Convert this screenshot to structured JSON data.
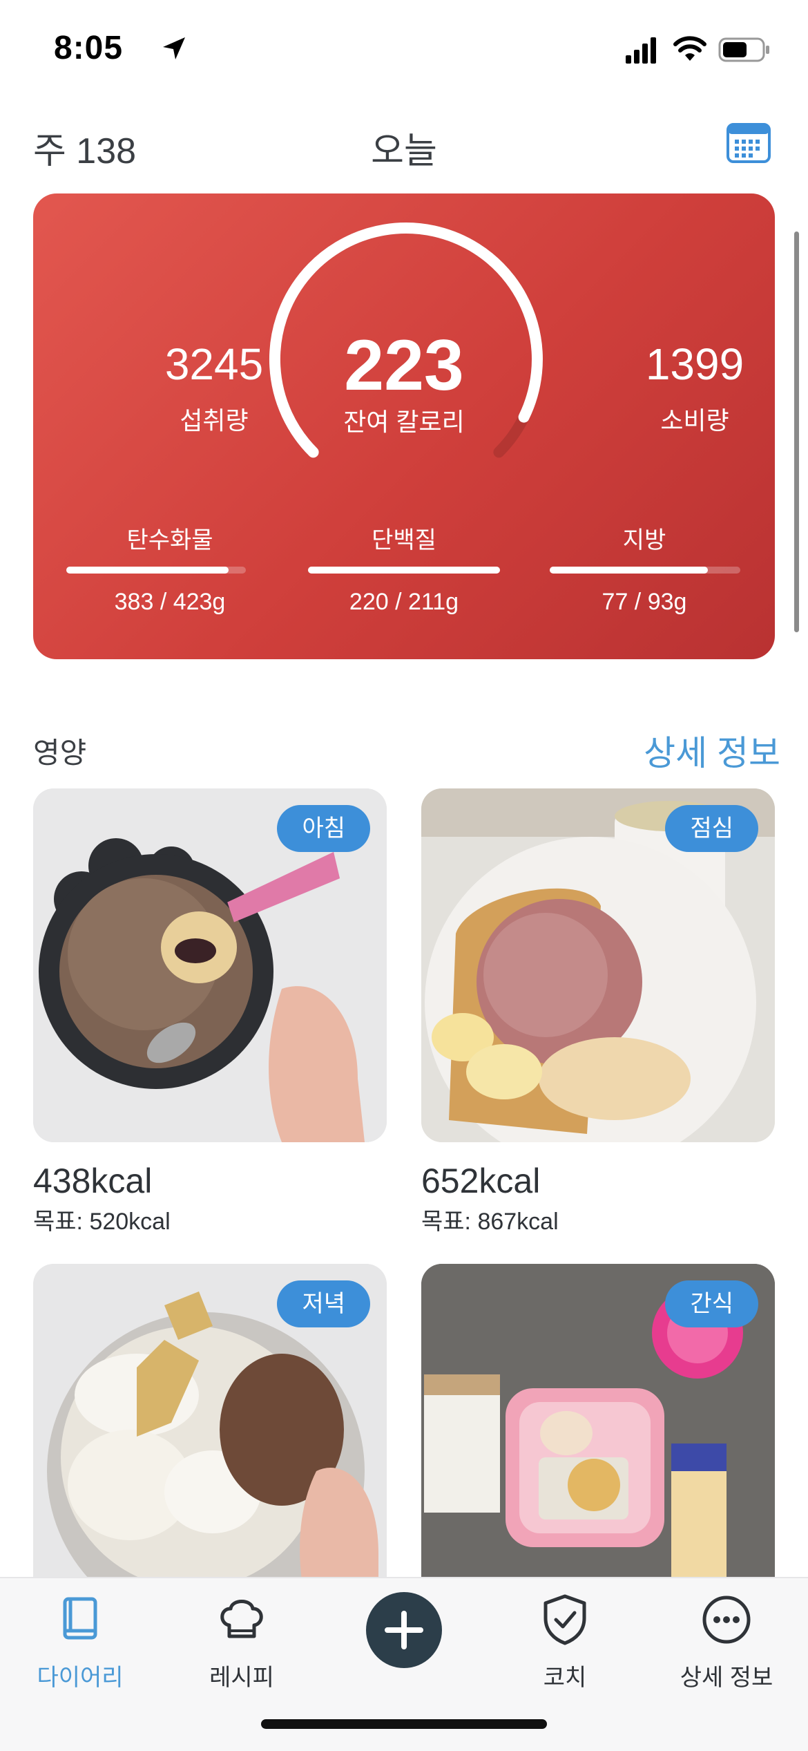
{
  "status_bar": {
    "time": "8:05"
  },
  "header": {
    "week_label": "주 138",
    "title": "오늘"
  },
  "summary": {
    "intake_value": "3245",
    "intake_label": "섭취량",
    "remaining_value": "223",
    "remaining_label": "잔여 칼로리",
    "burned_value": "1399",
    "burned_label": "소비량",
    "remaining_progress": 0.93,
    "macros": [
      {
        "name": "탄수화물",
        "value": "383 / 423g",
        "progress": 0.905
      },
      {
        "name": "단백질",
        "value": "220 / 211g",
        "progress": 1.0
      },
      {
        "name": "지방",
        "value": "77 / 93g",
        "progress": 0.83
      }
    ]
  },
  "nutrition_section": {
    "title": "영양",
    "link": "상세 정보"
  },
  "meals": [
    {
      "badge": "아침",
      "kcal": "438kcal",
      "goal": "목표: 520kcal"
    },
    {
      "badge": "점심",
      "kcal": "652kcal",
      "goal": "목표: 867kcal"
    },
    {
      "badge": "저녁"
    },
    {
      "badge": "간식"
    }
  ],
  "tabbar": {
    "items": [
      {
        "label": "다이어리",
        "icon": "book-icon",
        "active": true
      },
      {
        "label": "레시피",
        "icon": "chef-hat-icon"
      },
      {
        "label": "",
        "icon": "plus-icon"
      },
      {
        "label": "코치",
        "icon": "shield-check-icon"
      },
      {
        "label": "상세 정보",
        "icon": "more-icon"
      }
    ]
  },
  "colors": {
    "card_red": "#d1423d",
    "accent_blue": "#3d8fd9",
    "link_blue": "#4a99d6"
  }
}
